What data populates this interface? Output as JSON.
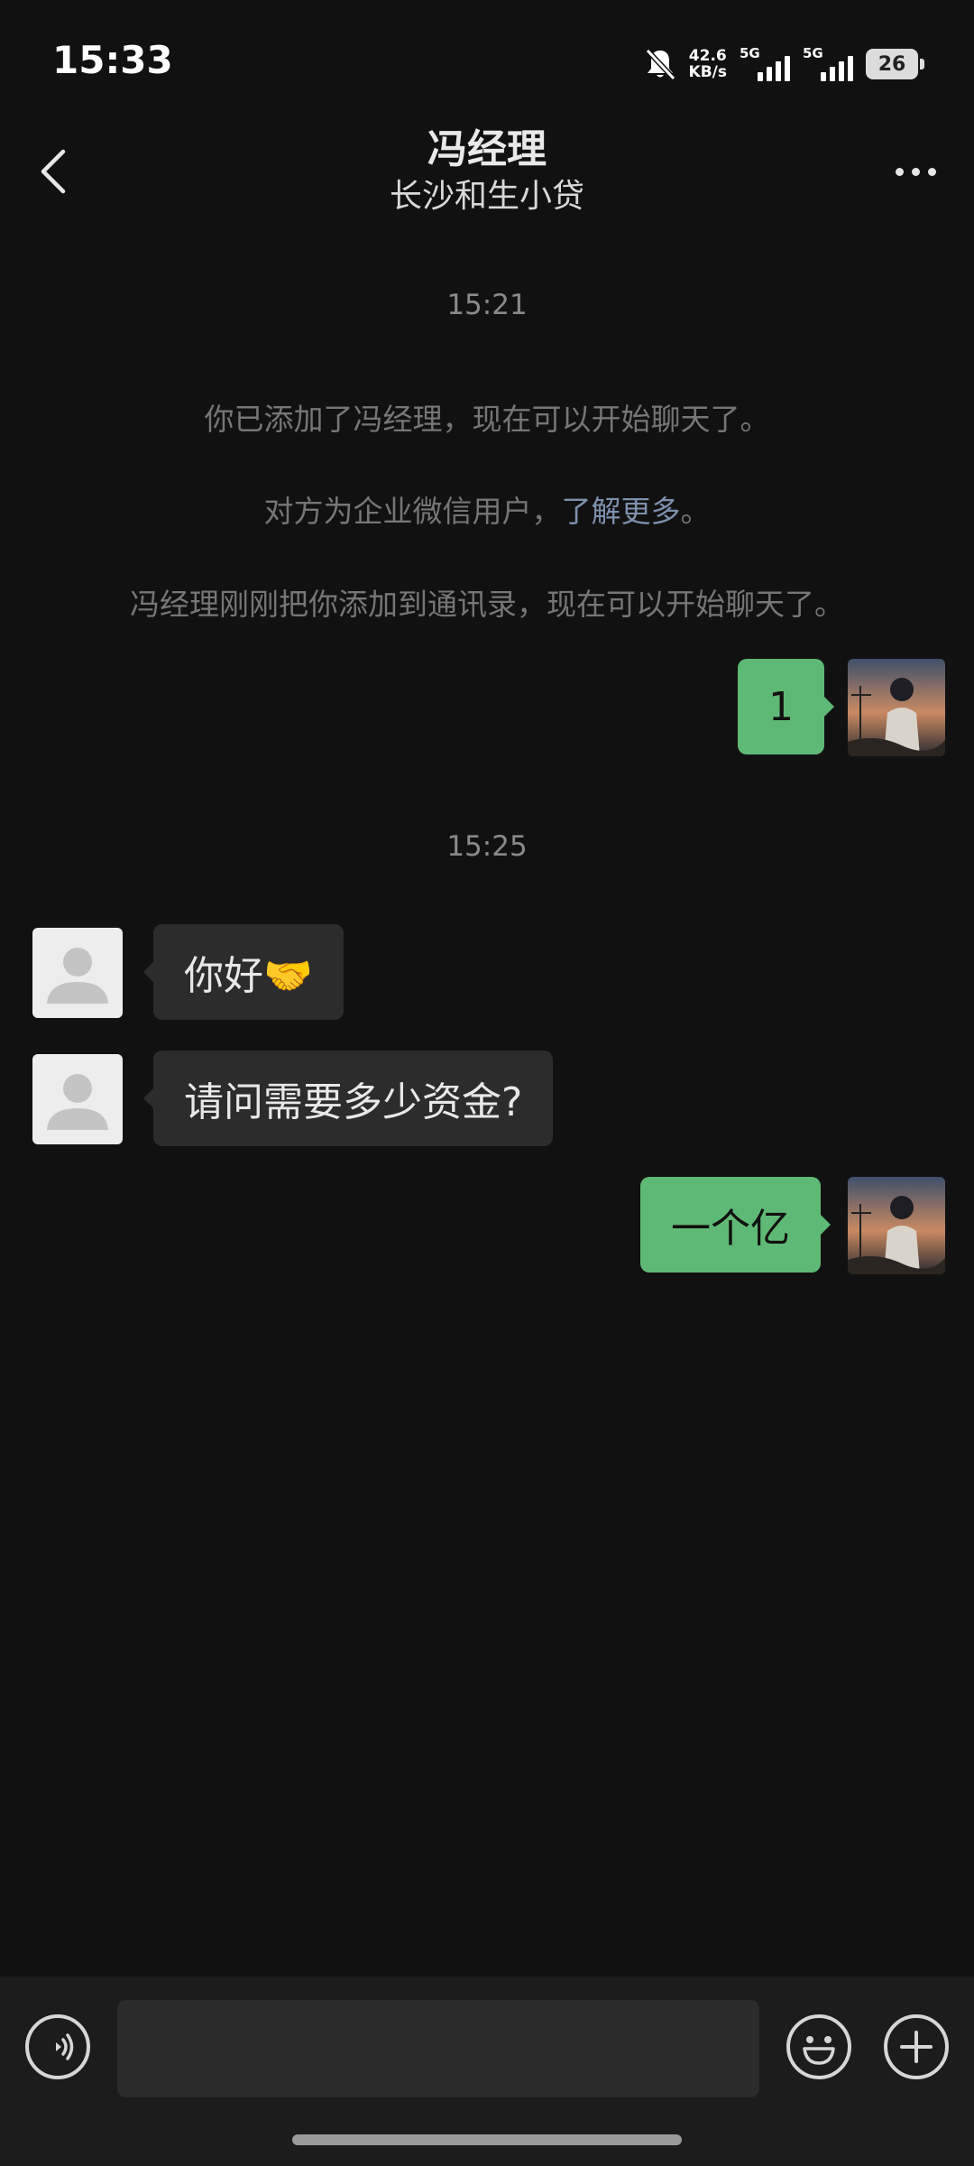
{
  "status_bar": {
    "time": "15:33",
    "net_speed_value": "42.6",
    "net_speed_unit": "KB/s",
    "sim1_type": "5G",
    "sim2_type": "5G",
    "battery_level": "26"
  },
  "header": {
    "title": "冯经理",
    "subtitle": "长沙和生小贷"
  },
  "chat": {
    "timestamp_1": "15:21",
    "system_1": "你已添加了冯经理，现在可以开始聊天了。",
    "system_2_prefix": "对方为企业微信用户，",
    "system_2_link": "了解更多",
    "system_2_suffix": "。",
    "system_3": "冯经理刚刚把你添加到通讯录，现在可以开始聊天了。",
    "timestamp_2": "15:25",
    "messages": [
      {
        "direction": "out",
        "text": "1"
      },
      {
        "direction": "in",
        "text": "你好🤝"
      },
      {
        "direction": "in",
        "text": "请问需要多少资金?"
      },
      {
        "direction": "out",
        "text": "一个亿"
      }
    ]
  },
  "input": {
    "value": ""
  },
  "colors": {
    "background": "#111111",
    "outgoing_bubble": "#5fb976",
    "incoming_bubble": "#2c2c2c",
    "link": "#7d90ad"
  }
}
